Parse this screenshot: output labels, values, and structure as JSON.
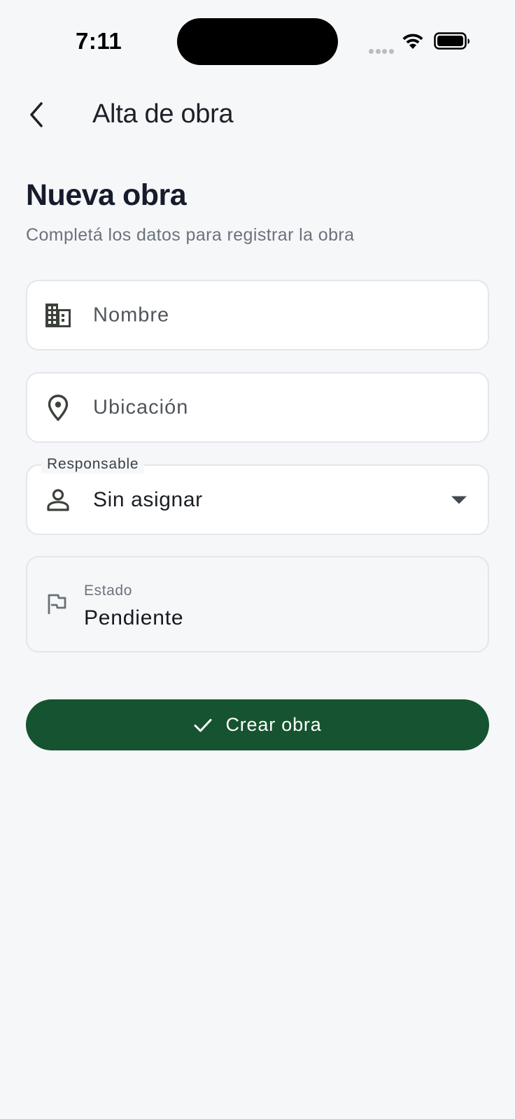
{
  "status_bar": {
    "time": "7:11",
    "icons": [
      "cellular-dots-icon",
      "wifi-icon",
      "battery-icon"
    ]
  },
  "app_bar": {
    "title": "Alta de obra",
    "back_icon": "chevron-left-icon"
  },
  "header": {
    "title": "Nueva obra",
    "subtitle": "Completá los datos para registrar la obra"
  },
  "form": {
    "nombre": {
      "placeholder": "Nombre",
      "icon": "building-icon"
    },
    "ubicacion": {
      "placeholder": "Ubicación",
      "icon": "location-pin-icon"
    },
    "responsable": {
      "label": "Responsable",
      "value": "Sin asignar",
      "icon": "person-icon"
    },
    "estado": {
      "label": "Estado",
      "value": "Pendiente",
      "icon": "flag-icon"
    }
  },
  "actions": {
    "submit_label": "Crear obra",
    "submit_icon": "check-icon"
  },
  "colors": {
    "background": "#f6f7f9",
    "primary": "#165330",
    "heading": "#161c2c",
    "muted": "#6c727c",
    "border": "#e3e6ea"
  }
}
